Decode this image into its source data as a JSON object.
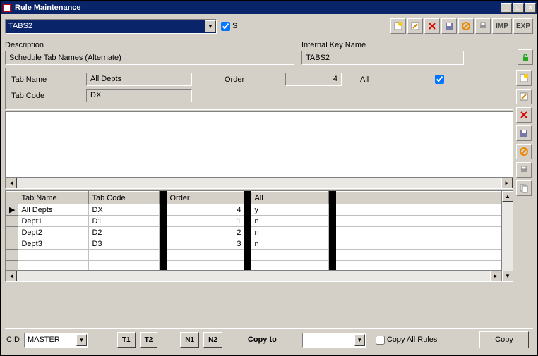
{
  "window": {
    "title": "Rule Maintenance"
  },
  "topcombo": {
    "value": "TABS2"
  },
  "s_check": {
    "label": "S",
    "checked": true
  },
  "toolbar_text": {
    "imp": "IMP",
    "exp": "EXP"
  },
  "labels": {
    "description": "Description",
    "internal_key": "Internal Key Name",
    "tab_name": "Tab Name",
    "tab_code": "Tab Code",
    "order": "Order",
    "all": "All",
    "cid": "CID",
    "copy_to": "Copy to",
    "copy_all": "Copy All Rules",
    "copy": "Copy",
    "t1": "T1",
    "t2": "T2",
    "n1": "N1",
    "n2": "N2"
  },
  "fields": {
    "description": "Schedule Tab Names (Alternate)",
    "internal_key": "TABS2",
    "tab_name": "All Depts",
    "tab_code": "DX",
    "order": "4"
  },
  "all_check": true,
  "cid": {
    "value": "MASTER"
  },
  "copy_to_value": "",
  "copy_all_checked": false,
  "grid": {
    "headers": [
      "Tab Name",
      "Tab Code",
      "Order",
      "All"
    ],
    "rows": [
      {
        "sel": "▶",
        "tab_name": "All Depts",
        "tab_code": "DX",
        "order": "4",
        "all": "y"
      },
      {
        "sel": "",
        "tab_name": "Dept1",
        "tab_code": "D1",
        "order": "1",
        "all": "n"
      },
      {
        "sel": "",
        "tab_name": "Dept2",
        "tab_code": "D2",
        "order": "2",
        "all": "n"
      },
      {
        "sel": "",
        "tab_name": "Dept3",
        "tab_code": "D3",
        "order": "3",
        "all": "n"
      }
    ]
  }
}
